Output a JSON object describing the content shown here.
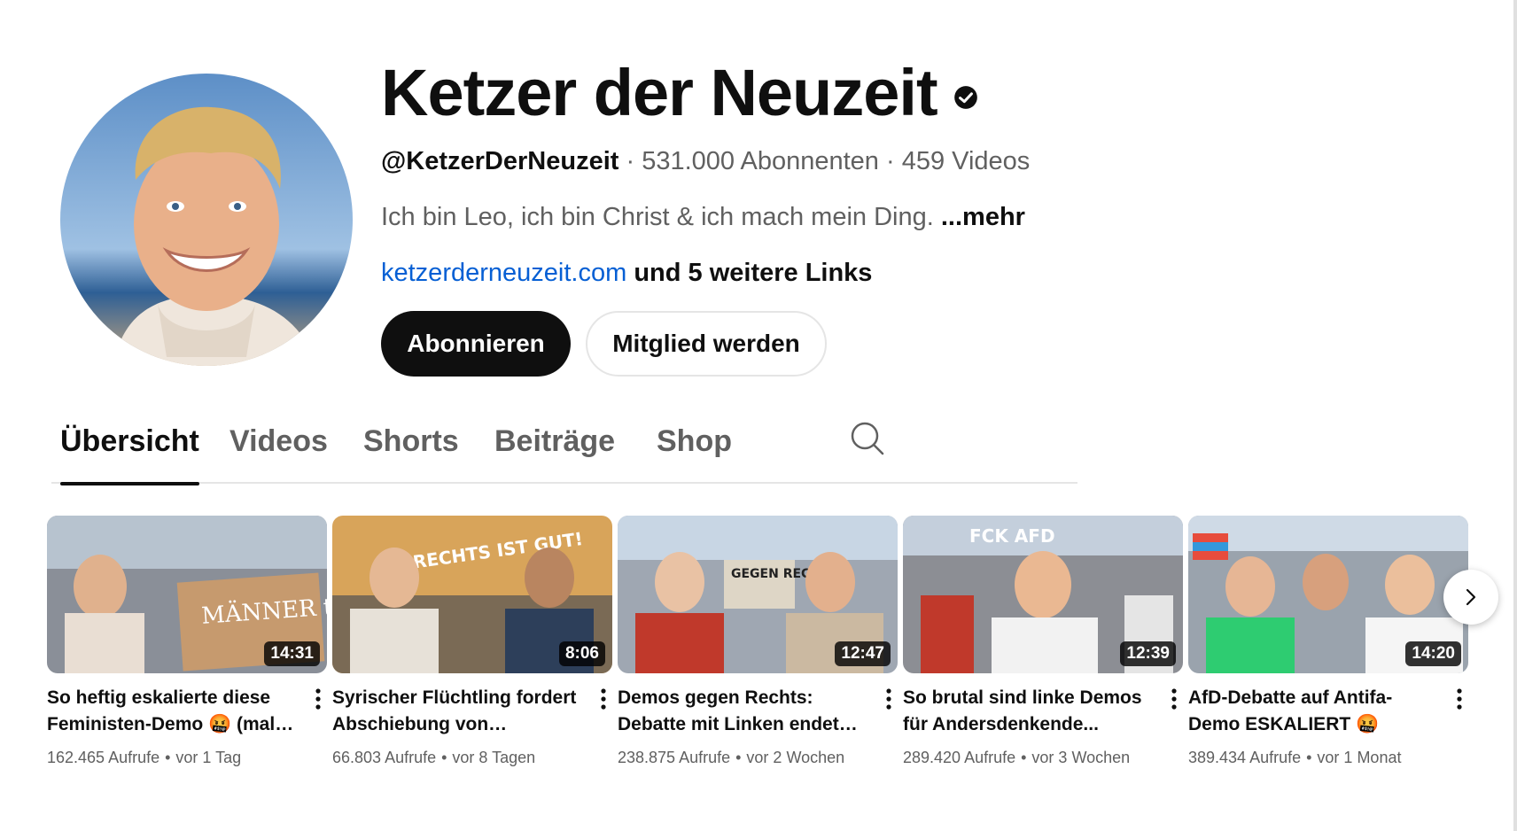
{
  "channel": {
    "name": "Ketzer der Neuzeit",
    "handle": "@KetzerDerNeuzeit",
    "subscribers": "531.000 Abonnenten",
    "videos_count": "459 Videos",
    "separator": " · ",
    "description": "Ich bin Leo, ich bin Christ & ich mach mein Ding.",
    "more_label": "...mehr",
    "link": "ketzerderneuzeit.com",
    "more_links": "und 5 weitere Links",
    "avatar_icon": "profile-photo",
    "verified_icon": "verified-check-icon"
  },
  "buttons": {
    "subscribe": "Abonnieren",
    "member": "Mitglied werden"
  },
  "tabs": [
    {
      "label": "Übersicht",
      "active": true
    },
    {
      "label": "Videos",
      "active": false
    },
    {
      "label": "Shorts",
      "active": false
    },
    {
      "label": "Beiträge",
      "active": false
    },
    {
      "label": "Shop",
      "active": false
    }
  ],
  "videos": [
    {
      "title": "So heftig eskalierte diese Feministen-Demo 🤬 (mal…",
      "duration": "14:31",
      "views": "162.465 Aufrufe",
      "age": "vor 1 Tag",
      "thumb_text": "MÄNNER töten."
    },
    {
      "title": "Syrischer Flüchtling fordert Abschiebung von…",
      "duration": "8:06",
      "views": "66.803 Aufrufe",
      "age": "vor 8 Tagen",
      "thumb_text": "RECHTS IST GUT!"
    },
    {
      "title": "Demos gegen Rechts: Debatte mit Linken endet…",
      "duration": "12:47",
      "views": "238.875 Aufrufe",
      "age": "vor 2 Wochen",
      "thumb_text": "GEGEN RECHTS"
    },
    {
      "title": "So brutal sind linke Demos für Andersdenkende...",
      "duration": "12:39",
      "views": "289.420 Aufrufe",
      "age": "vor 3 Wochen",
      "thumb_text": "FCK AFD"
    },
    {
      "title": "AfD-Debatte auf Antifa-Demo ESKALIERT 🤬",
      "duration": "14:20",
      "views": "389.434 Aufrufe",
      "age": "vor 1 Monat",
      "thumb_text": ""
    }
  ],
  "meta_dot": "•",
  "colors": {
    "text_primary": "#0f0f0f",
    "text_secondary": "#606060",
    "link": "#065fd4",
    "subscribe_bg": "#0f0f0f"
  }
}
